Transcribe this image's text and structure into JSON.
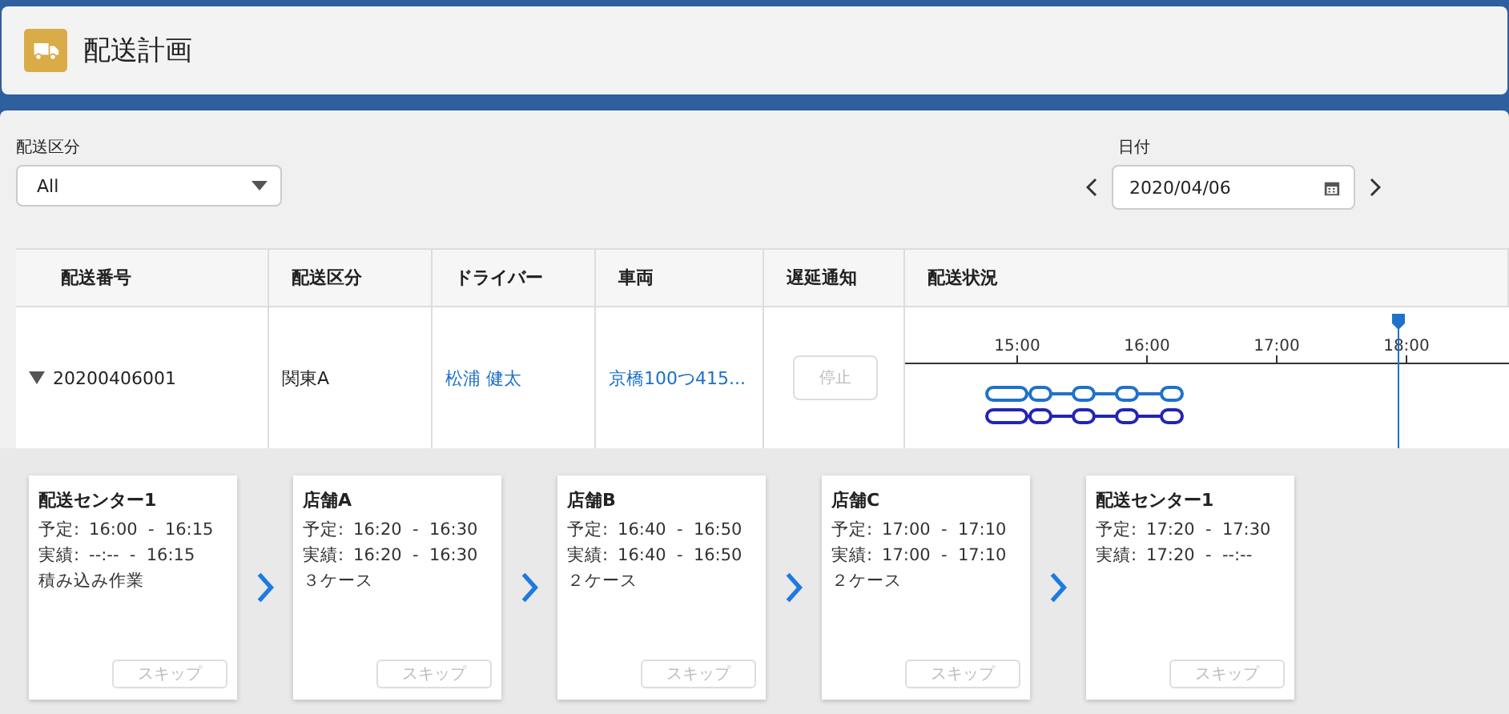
{
  "header": {
    "title": "配送計画"
  },
  "filters": {
    "category": {
      "label": "配送区分",
      "value": "All"
    },
    "date": {
      "label": "日付",
      "value": "2020/04/06"
    }
  },
  "table": {
    "columns": [
      "配送番号",
      "配送区分",
      "ドライバー",
      "車両",
      "遅延通知",
      "配送状況"
    ],
    "rows": [
      {
        "expanded": true,
        "number": "20200406001",
        "category": "関東A",
        "driver": "松浦 健太",
        "vehicle": "京橋100つ415...",
        "stop_button": {
          "label": "停止",
          "disabled": true
        },
        "timeline": {
          "ticks": [
            "15:00",
            "16:00",
            "17:00",
            "18:00"
          ],
          "tracks": [
            {
              "color": "#1f72c8"
            },
            {
              "color": "#2424b4"
            }
          ]
        }
      }
    ]
  },
  "stops": [
    {
      "title": "配送センター1",
      "plan_label": "予定:",
      "plan": "16:00  -  16:15",
      "actual_label": "実績:",
      "actual": "--:--  -  16:15",
      "note": "積み込み作業",
      "skip": {
        "label": "スキップ",
        "disabled": true
      }
    },
    {
      "title": "店舗A",
      "plan_label": "予定:",
      "plan": "16:20  -  16:30",
      "actual_label": "実績:",
      "actual": "16:20  -  16:30",
      "note": "３ケース",
      "skip": {
        "label": "スキップ",
        "disabled": true
      }
    },
    {
      "title": "店舗B",
      "plan_label": "予定:",
      "plan": "16:40  -  16:50",
      "actual_label": "実績:",
      "actual": "16:40  -  16:50",
      "note": "２ケース",
      "skip": {
        "label": "スキップ",
        "disabled": true
      }
    },
    {
      "title": "店舗C",
      "plan_label": "予定:",
      "plan": "17:00  -  17:10",
      "actual_label": "実績:",
      "actual": "17:00  -  17:10",
      "note": "２ケース",
      "skip": {
        "label": "スキップ",
        "disabled": true
      }
    },
    {
      "title": "配送センター1",
      "plan_label": "予定:",
      "plan": "17:20  -  17:30",
      "actual_label": "実績:",
      "actual": "17:20  -  --:--",
      "skip": {
        "label": "スキップ",
        "disabled": true
      }
    }
  ]
}
